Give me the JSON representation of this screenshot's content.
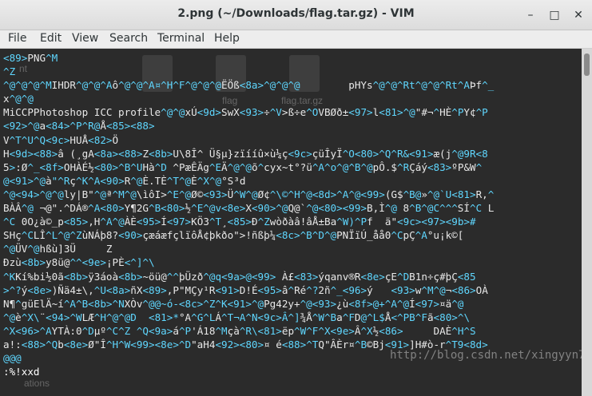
{
  "window": {
    "title": "2.png (~/Downloads/flag.tar.gz) - VIM",
    "minimize_icon": "minimize-icon",
    "maximize_icon": "maximize-icon",
    "close_icon": "close-icon"
  },
  "menubar": {
    "items": [
      "File",
      "Edit",
      "View",
      "Search",
      "Terminal",
      "Help"
    ]
  },
  "desktop_ghost": {
    "icon1_label": "flag",
    "icon2_label": "flag.tar.gz",
    "ghost_text1": "nt",
    "ghost_text2": "ations"
  },
  "colors": {
    "special_chars": "#5fd7ff",
    "text": "#e8e8e8",
    "background": "#2b2b2b"
  },
  "vim": {
    "lines": [
      [
        [
          "c",
          "<89>"
        ],
        [
          "t",
          "PNG"
        ],
        [
          "c",
          "^M"
        ]
      ],
      [
        [
          "c",
          "^Z"
        ]
      ],
      [
        [
          "c",
          "^@^@^@^M"
        ],
        [
          "t",
          "IHDR"
        ],
        [
          "c",
          "^@^@^A"
        ],
        [
          "t",
          "ô"
        ],
        [
          "c",
          "^@^@^A¤^H^F^@^@^@"
        ],
        [
          "t",
          "ËÖß"
        ],
        [
          "c",
          "<8a>^@^@^@"
        ],
        [
          "t",
          "        pHYs"
        ],
        [
          "c",
          "^@^@^Rt^@^@^Rt^A"
        ],
        [
          "t",
          "Þf"
        ],
        [
          "c",
          "^_"
        ]
      ],
      [
        [
          "t",
          "x"
        ],
        [
          "c",
          "^@^@"
        ]
      ],
      [
        [
          "t",
          "MiCCPPhotoshop ICC profile"
        ],
        [
          "c",
          "^@^@"
        ],
        [
          "t",
          "xÚ"
        ],
        [
          "c",
          "<9d>"
        ],
        [
          "t",
          "SwX"
        ],
        [
          "c",
          "<93>"
        ],
        [
          "t",
          "÷"
        ],
        [
          "c",
          "^V"
        ],
        [
          "t",
          ">ß÷e"
        ],
        [
          "c",
          "^O"
        ],
        [
          "t",
          "VBØð±"
        ],
        [
          "c",
          "<97>"
        ],
        [
          "t",
          "l"
        ],
        [
          "c",
          "<81>^@"
        ],
        [
          "t",
          "\"#¬"
        ],
        [
          "c",
          "^"
        ],
        [
          "t",
          "HÈ"
        ],
        [
          "c",
          "^P"
        ],
        [
          "t",
          "Y¢"
        ],
        [
          "c",
          "^P"
        ]
      ],
      [
        [
          "c",
          "<92>^@"
        ],
        [
          "t",
          "a"
        ],
        [
          "c",
          "<84>^P^R@"
        ],
        [
          "t",
          "Å"
        ],
        [
          "c",
          "<85><88>"
        ]
      ],
      [
        [
          "t",
          "V"
        ],
        [
          "c",
          "^T^U^Q<9c>"
        ],
        [
          "t",
          "HUÅ"
        ],
        [
          "c",
          "<82>"
        ],
        [
          "t",
          "Ö"
        ]
      ],
      [
        [
          "t",
          "H"
        ],
        [
          "c",
          "<9d><88>"
        ],
        [
          "t",
          "â (¸g"
        ],
        [
          "t",
          "A"
        ],
        [
          "c",
          "<8a><88>"
        ],
        [
          "t",
          "Z"
        ],
        [
          "c",
          "<8b>"
        ],
        [
          "t",
          "U\\8Î^ Ü§µ}zïííû×ù¼ç"
        ],
        [
          "c",
          "<9c>"
        ],
        [
          "t",
          "çüÎyÏ"
        ],
        [
          "c",
          "^O<80>^Q^R&<91>"
        ],
        [
          "t",
          "æ(j"
        ],
        [
          "c",
          "^@9R<8"
        ]
      ],
      [
        [
          "t",
          "5"
        ],
        [
          "c",
          ">"
        ],
        [
          "t",
          ":Ø"
        ],
        [
          "c",
          "^_<8f>"
        ],
        [
          "t",
          "OHÀÉ½"
        ],
        [
          "c",
          "<80>^B^U"
        ],
        [
          "t",
          "Hà"
        ],
        [
          "c",
          "^D"
        ],
        [
          "t",
          " ^PæÊÄg"
        ],
        [
          "c",
          "^E"
        ],
        [
          "t",
          "Ä"
        ],
        [
          "c",
          "^@^@"
        ],
        [
          "t",
          "õ"
        ],
        [
          "c",
          "^"
        ],
        [
          "t",
          "cyx~t°?ü"
        ],
        [
          "c",
          "^A^o^@^B^@"
        ],
        [
          "t",
          "pÔ.$"
        ],
        [
          "c",
          "^R"
        ],
        [
          "t",
          "Çáý"
        ],
        [
          "c",
          "<83>"
        ],
        [
          "t",
          "ºP&W"
        ],
        [
          "c",
          "^"
        ]
      ],
      [
        [
          "c",
          "@<91>^@"
        ],
        [
          "t",
          "à"
        ],
        [
          "c",
          "\"^R"
        ],
        [
          "t",
          "ç"
        ],
        [
          "c",
          "^K^A<90>"
        ],
        [
          "t",
          "R"
        ],
        [
          "c",
          "^@"
        ],
        [
          "t",
          "È.TÈ"
        ],
        [
          "c",
          "^T^@"
        ],
        [
          "t",
          "È"
        ],
        [
          "c",
          "^X^@"
        ],
        [
          "t",
          "°S³d"
        ]
      ],
      [
        [
          "c",
          "^@<94>^@^@"
        ],
        [
          "t",
          "ly|B\""
        ],
        [
          "c",
          "^@"
        ],
        [
          "t",
          "ª"
        ],
        [
          "c",
          "^M^@"
        ],
        [
          "t",
          "\\ìôI>"
        ],
        [
          "c",
          "^E^@"
        ],
        [
          "t",
          "Ø©"
        ],
        [
          "c",
          "<93>"
        ],
        [
          "t",
          "Ü"
        ],
        [
          "c",
          "^W^@"
        ],
        [
          "t",
          "Ø¢"
        ],
        [
          "c",
          "^\\©^H^@<8d>^A^@<99>"
        ],
        [
          "t",
          "(G$"
        ],
        [
          "c",
          "^B@"
        ],
        [
          "t",
          "»"
        ],
        [
          "c",
          "^@`U<81>"
        ],
        [
          "t",
          "R,"
        ],
        [
          "c",
          "^"
        ]
      ],
      [
        [
          "t",
          "BÀÂ"
        ],
        [
          "c",
          "^@"
        ],
        [
          "t",
          " ¬@\".^DÁ®"
        ],
        [
          "c",
          "^A<80>"
        ],
        [
          "t",
          "Y¶2G"
        ],
        [
          "c",
          "^B<80>"
        ],
        [
          "t",
          "½"
        ],
        [
          "c",
          "^E^@v<8e>"
        ],
        [
          "t",
          "X"
        ],
        [
          "c",
          "<90>^@"
        ],
        [
          "t",
          "Q@`"
        ],
        [
          "c",
          "^@<80><99>"
        ],
        [
          "t",
          "B,Ì"
        ],
        [
          "c",
          "^@"
        ],
        [
          "t",
          " 8"
        ],
        [
          "c",
          "^B^@C^^^"
        ],
        [
          "t",
          "SÍ"
        ],
        [
          "c",
          "^C"
        ],
        [
          "t",
          " L"
        ]
      ],
      [
        [
          "c",
          "^C"
        ],
        [
          "t",
          " 0O¿à©_p"
        ],
        [
          "c",
          "<85>"
        ],
        [
          "t",
          ",H"
        ],
        [
          "c",
          "^A^@"
        ],
        [
          "t",
          "ÀÈ"
        ],
        [
          "c",
          "<95>"
        ],
        [
          "t",
          "Í"
        ],
        [
          "c",
          "<97>"
        ],
        [
          "t",
          "KÖ3"
        ],
        [
          "c",
          "^T"
        ],
        [
          "t",
          "¸"
        ],
        [
          "c",
          "<85>"
        ],
        [
          "t",
          "Ð"
        ],
        [
          "c",
          "^Z"
        ],
        [
          "t",
          "wòðàâ!âÅ±Ba"
        ],
        [
          "c",
          "^W)^P"
        ],
        [
          "t",
          "f  ä\""
        ],
        [
          "c",
          "<9c><97><9b>#"
        ]
      ],
      [
        [
          "t",
          "SHç"
        ],
        [
          "c",
          "^C"
        ],
        [
          "t",
          "LÎ"
        ],
        [
          "c",
          "^L^@^Z"
        ],
        [
          "t",
          "ùNÁþ8?"
        ],
        [
          "c",
          "<90>"
        ],
        [
          "t",
          "çæáæfçlïôÅ¢þkðo\">!ñßþ¼"
        ],
        [
          "c",
          "<8c>^B^D^@"
        ],
        [
          "t",
          "PNÏïÚ_åå0"
        ],
        [
          "c",
          "^C"
        ],
        [
          "t",
          "pÇ"
        ],
        [
          "c",
          "^A"
        ],
        [
          "t",
          "°u¡k©["
        ]
      ],
      [
        [
          "c",
          "^@"
        ],
        [
          "t",
          "ÜV"
        ],
        [
          "c",
          "^@"
        ],
        [
          "t",
          "hßù]3Ü     Z"
        ]
      ],
      [
        [
          "t",
          "Ðzù"
        ],
        [
          "c",
          "<8b>"
        ],
        [
          "t",
          "y8ü@"
        ],
        [
          "c",
          "^^<9e>"
        ],
        [
          "t",
          "¡PÈ"
        ],
        [
          "c",
          "<^]^\\"
        ]
      ],
      [
        [
          "c",
          "^K"
        ],
        [
          "t",
          "Kí%bi½0ã"
        ],
        [
          "c",
          "<8b>"
        ],
        [
          "t",
          "ÿ3áoà"
        ],
        [
          "c",
          "<8b>"
        ],
        [
          "t",
          "~öü@"
        ],
        [
          "c",
          "^^"
        ],
        [
          "t",
          "þÜzð"
        ],
        [
          "c",
          "^@q<9a>@<99>"
        ],
        [
          "t",
          " À£"
        ],
        [
          "c",
          "<83>"
        ],
        [
          "t",
          "ýqanv®R"
        ],
        [
          "c",
          "<8e>"
        ],
        [
          "t",
          "çE"
        ],
        [
          "c",
          "^D"
        ],
        [
          "t",
          "B1n÷ç#þÇ"
        ],
        [
          "c",
          "<85"
        ]
      ],
      [
        [
          "c",
          ">^?"
        ],
        [
          "t",
          "ý"
        ],
        [
          "c",
          "<8e>"
        ],
        [
          "t",
          ")Ñä4±\\,"
        ],
        [
          "c",
          "^U<8a>"
        ],
        [
          "t",
          "ñX"
        ],
        [
          "c",
          "<89>"
        ],
        [
          "t",
          ",P\"MÇy¹R"
        ],
        [
          "c",
          "<91>"
        ],
        [
          "t",
          "D!É"
        ],
        [
          "c",
          "<95>"
        ],
        [
          "t",
          "â"
        ],
        [
          "c",
          "^"
        ],
        [
          "t",
          "Ré"
        ],
        [
          "c",
          "^?"
        ],
        [
          "t",
          "2ñ"
        ],
        [
          "c",
          "^_<96>"
        ],
        [
          "t",
          "ý   "
        ],
        [
          "c",
          "<93>"
        ],
        [
          "t",
          "w"
        ],
        [
          "c",
          "^M^@"
        ],
        [
          "t",
          "¬"
        ],
        [
          "c",
          "<86>"
        ],
        [
          "t",
          "OÀ"
        ]
      ],
      [
        [
          "t",
          "N¶"
        ],
        [
          "c",
          "^"
        ],
        [
          "t",
          "güElÄ~í"
        ],
        [
          "c",
          "^A^B<8b>^N"
        ],
        [
          "t",
          "XÒv"
        ],
        [
          "c",
          "^@@~ó-<8c>^Z^K<91>^@"
        ],
        [
          "t",
          "Pg42y+"
        ],
        [
          "c",
          "^@<93>"
        ],
        [
          "t",
          "¿ù"
        ],
        [
          "c",
          "<8f>@+^A^@"
        ],
        [
          "t",
          "Í"
        ],
        [
          "c",
          "<97>"
        ],
        [
          "t",
          "¤ä"
        ],
        [
          "c",
          "^@"
        ]
      ],
      [
        [
          "c",
          "^@"
        ],
        [
          "t",
          "è"
        ],
        [
          "c",
          "^X\\"
        ],
        [
          "t",
          "¨"
        ],
        [
          "c",
          "<94>^W"
        ],
        [
          "t",
          "LÆ"
        ],
        [
          "c",
          "^H^@^@D  <81>*"
        ],
        [
          "t",
          "°A"
        ],
        [
          "c",
          "^G^L"
        ],
        [
          "t",
          "Á"
        ],
        [
          "c",
          "^T¬A^N<9c>Â^]"
        ],
        [
          "t",
          "¾Å"
        ],
        [
          "c",
          "^W^B"
        ],
        [
          "t",
          "a"
        ],
        [
          "c",
          "^F"
        ],
        [
          "t",
          "D"
        ],
        [
          "c",
          "@^L$"
        ],
        [
          "t",
          "Å"
        ],
        [
          "c",
          "<^PB^F"
        ],
        [
          "t",
          "ã"
        ],
        [
          "c",
          "<80>^\\"
        ]
      ],
      [
        [
          "c",
          "^X<96>^A"
        ],
        [
          "t",
          "YTÀ:0"
        ],
        [
          "c",
          "^D"
        ],
        [
          "t",
          "µº"
        ],
        [
          "c",
          "^C^Z ^Q<9a>"
        ],
        [
          "t",
          "á"
        ],
        [
          "c",
          "^P"
        ],
        [
          "t",
          "'Á18"
        ],
        [
          "c",
          "^M"
        ],
        [
          "t",
          "çà"
        ],
        [
          "c",
          "^R\\<81>"
        ],
        [
          "t",
          "ëp"
        ],
        [
          "c",
          "^W^F^X<9e>"
        ],
        [
          "t",
          "Â"
        ],
        [
          "c",
          "^X"
        ],
        [
          "t",
          "½"
        ],
        [
          "c",
          "<86>     "
        ],
        [
          "t",
          "DAÈ"
        ],
        [
          "c",
          "^H^S"
        ]
      ],
      [
        [
          "t",
          "a!:"
        ],
        [
          "c",
          "<88>^Q"
        ],
        [
          "t",
          "b"
        ],
        [
          "c",
          "<8e>"
        ],
        [
          "t",
          "Ø\"Î"
        ],
        [
          "c",
          "^H^W<99><8e>^D"
        ],
        [
          "t",
          "\"aH4"
        ],
        [
          "c",
          "<92><80>"
        ],
        [
          "t",
          "¤ é"
        ],
        [
          "c",
          "<88>^T"
        ],
        [
          "t",
          "Q\"ÂÈr¤"
        ],
        [
          "c",
          "^B"
        ],
        [
          "t",
          "©Bj"
        ],
        [
          "c",
          "<91>"
        ],
        [
          "t",
          "]H#ò-r"
        ],
        [
          "c",
          "^T9<8d>"
        ]
      ],
      [
        [
          "c",
          "@@@"
        ]
      ],
      [
        [
          "t",
          ":%!xxd",
          "cmd"
        ]
      ]
    ]
  },
  "watermark": "http://blog.csdn.net/xingyyn78"
}
